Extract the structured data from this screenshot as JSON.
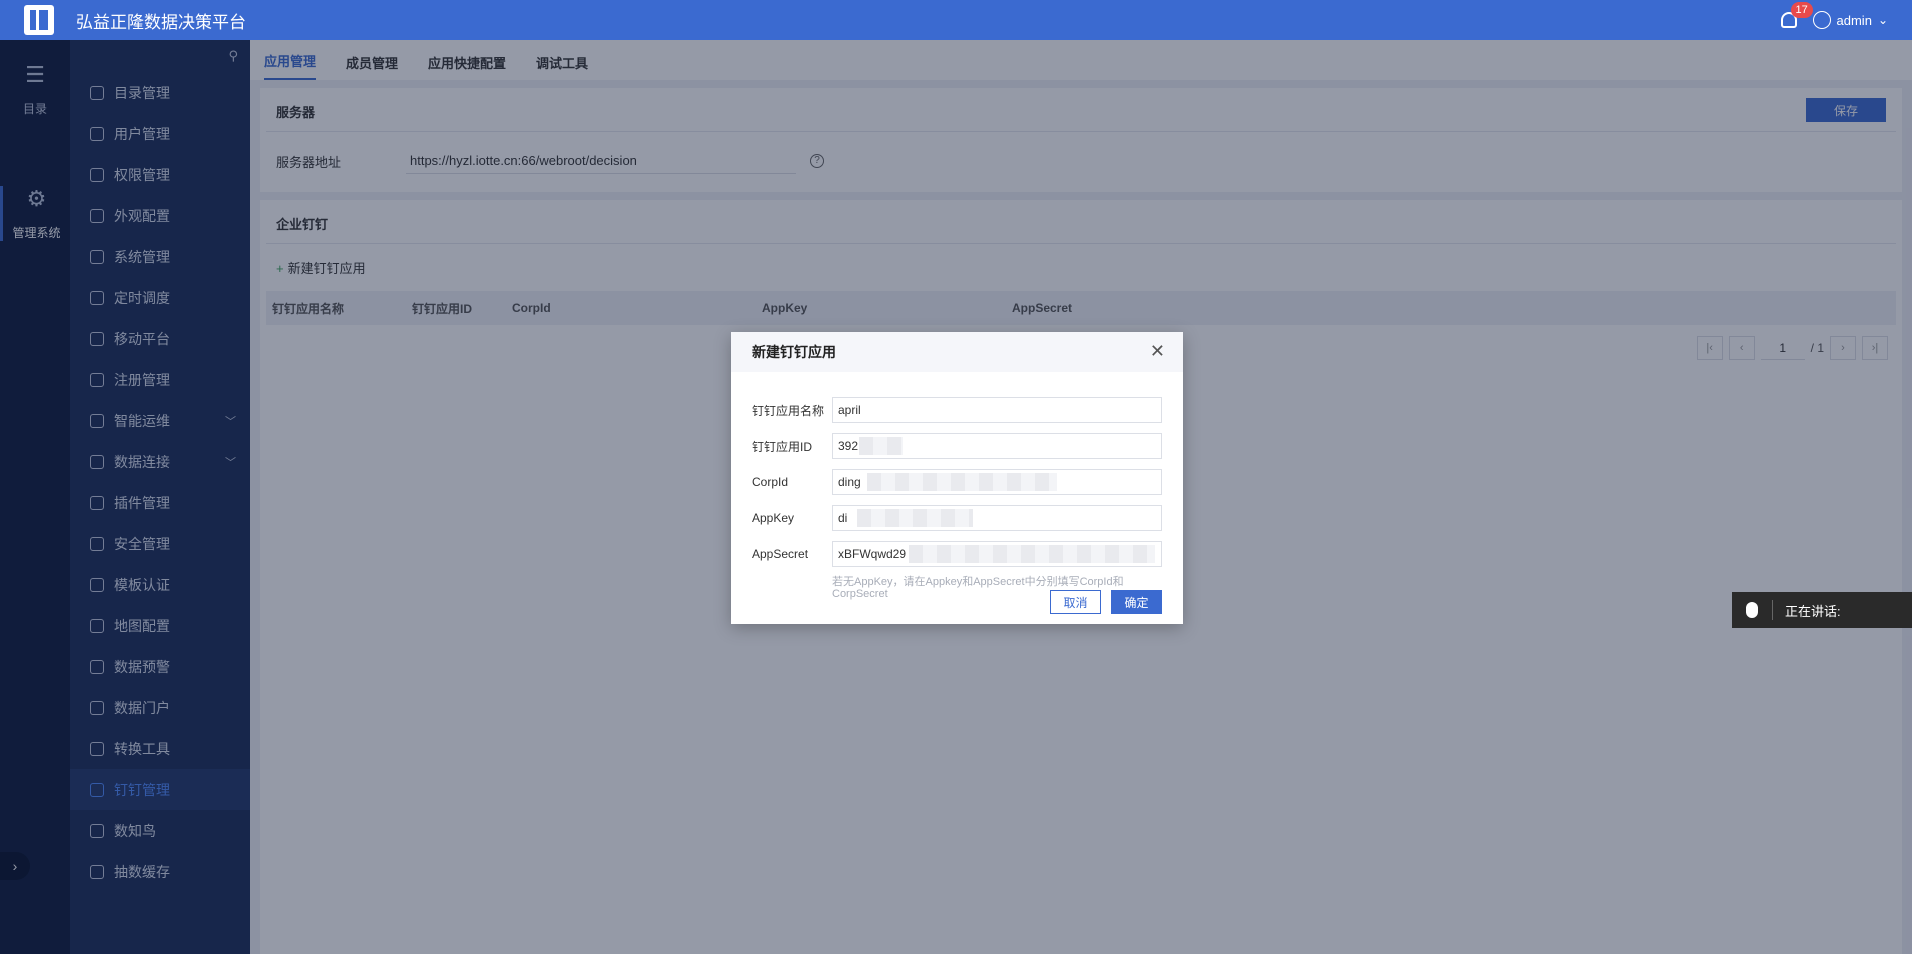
{
  "header": {
    "title": "弘益正隆数据决策平台",
    "notification_count": "17",
    "user": "admin"
  },
  "rail": {
    "items": [
      {
        "label": "目录",
        "icon": "list-icon"
      },
      {
        "label": "管理系统",
        "icon": "gear-icon"
      }
    ]
  },
  "sidebar": {
    "items": [
      {
        "label": "目录管理",
        "icon": "list-icon"
      },
      {
        "label": "用户管理",
        "icon": "user-icon"
      },
      {
        "label": "权限管理",
        "icon": "shield-icon"
      },
      {
        "label": "外观配置",
        "icon": "brush-icon"
      },
      {
        "label": "系统管理",
        "icon": "gear-icon"
      },
      {
        "label": "定时调度",
        "icon": "timer-icon"
      },
      {
        "label": "移动平台",
        "icon": "mobile-icon"
      },
      {
        "label": "注册管理",
        "icon": "register-icon"
      },
      {
        "label": "智能运维",
        "icon": "ops-icon",
        "expandable": true
      },
      {
        "label": "数据连接",
        "icon": "link-icon",
        "expandable": true
      },
      {
        "label": "插件管理",
        "icon": "plugin-icon"
      },
      {
        "label": "安全管理",
        "icon": "security-icon"
      },
      {
        "label": "模板认证",
        "icon": "template-icon"
      },
      {
        "label": "地图配置",
        "icon": "map-icon"
      },
      {
        "label": "数据预警",
        "icon": "bell-icon"
      },
      {
        "label": "数据门户",
        "icon": "portal-icon"
      },
      {
        "label": "转换工具",
        "icon": "convert-icon"
      },
      {
        "label": "钉钉管理",
        "icon": "dingtalk-icon",
        "active": true
      },
      {
        "label": "数知鸟",
        "icon": "plugin-icon"
      },
      {
        "label": "抽数缓存",
        "icon": "gear-icon"
      }
    ]
  },
  "tabs": [
    {
      "label": "应用管理",
      "active": true
    },
    {
      "label": "成员管理"
    },
    {
      "label": "应用快捷配置"
    },
    {
      "label": "调试工具"
    }
  ],
  "server": {
    "title": "服务器",
    "save_label": "保存",
    "address_label": "服务器地址",
    "address_value": "https://hyzl.iotte.cn:66/webroot/decision"
  },
  "dingtalk": {
    "title": "企业钉钉",
    "add_label": "新建钉钉应用",
    "columns": [
      "钉钉应用名称",
      "钉钉应用ID",
      "CorpId",
      "AppKey",
      "AppSecret"
    ],
    "pager": {
      "current": "1",
      "total": "/ 1"
    }
  },
  "dialog": {
    "title": "新建钉钉应用",
    "fields": [
      {
        "label": "钉钉应用名称",
        "value": "april"
      },
      {
        "label": "钉钉应用ID",
        "value": "392"
      },
      {
        "label": "CorpId",
        "value": "ding"
      },
      {
        "label": "AppKey",
        "value": "di"
      },
      {
        "label": "AppSecret",
        "value": "xBFWqwd29"
      }
    ],
    "hint": "若无AppKey，请在Appkey和AppSecret中分别填写CorpId和CorpSecret",
    "cancel_label": "取消",
    "ok_label": "确定"
  },
  "speaking": {
    "label": "正在讲话:"
  }
}
